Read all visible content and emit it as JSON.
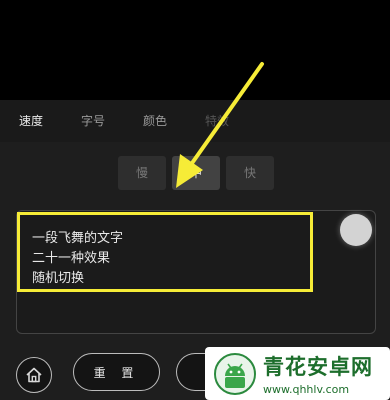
{
  "tabs": [
    "速度",
    "字号",
    "颜色",
    "特效"
  ],
  "active_tab": "速度",
  "speed": {
    "slow": "慢",
    "mid": "中",
    "fast": "快",
    "selected": "中"
  },
  "text_lines": [
    "一段飞舞的文字",
    "二十一种效果",
    "随机切换"
  ],
  "buttons": {
    "reset": "重 置"
  },
  "watermark": {
    "title": "青花安卓网",
    "url": "www.qhhlv.com"
  },
  "colors": {
    "highlight": "#f6ec37",
    "arrow": "#f6ec37",
    "watermark": "#1d6e2c"
  },
  "icons": {
    "home": "home-icon",
    "slider": "slider-knob"
  }
}
